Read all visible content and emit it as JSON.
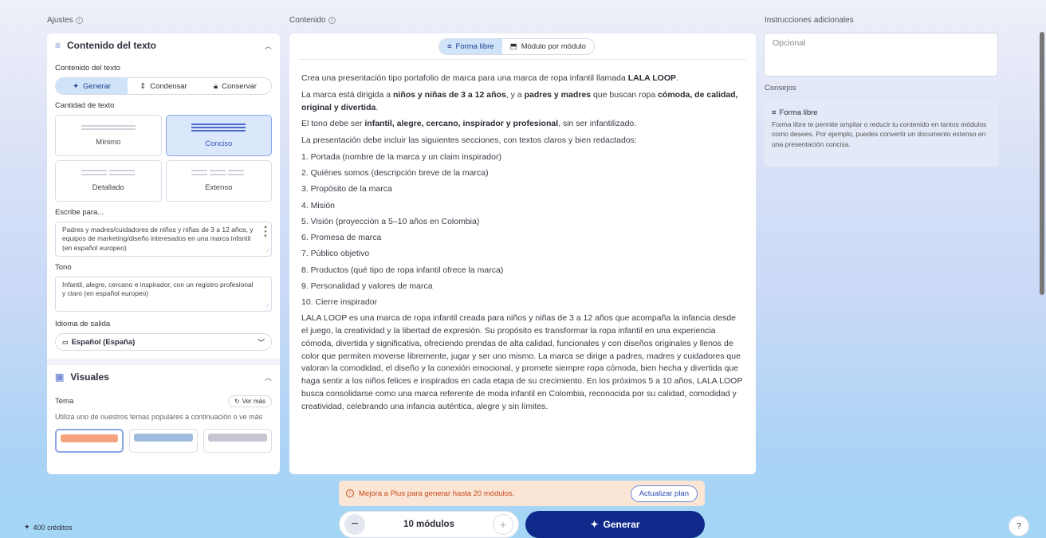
{
  "labels": {
    "ajustes": "Ajustes",
    "contenido": "Contenido",
    "instrucciones": "Instrucciones adicionales",
    "consejos": "Consejos"
  },
  "left": {
    "section_text": {
      "title": "Contenido del texto",
      "sub_label": "Contenido del texto",
      "modes": [
        "Generar",
        "Condensar",
        "Conservar"
      ],
      "cantidad_label": "Cantidad de texto",
      "amounts": [
        "Mínimo",
        "Conciso",
        "Detallado",
        "Extenso"
      ],
      "escribe_label": "Escribe para...",
      "escribe_value": "Padres y madres/cuidadores de niños y niñas de 3 a 12 años, y equipos de marketing/diseño interesados en una marca infantil (en español europeo)",
      "tono_label": "Tono",
      "tono_value": "Infantil, alegre, cercano e inspirador, con un registro profesional y claro (en español europeo)",
      "idioma_label": "Idioma de salida",
      "idioma_value": "Español (España)"
    },
    "section_visuals": {
      "title": "Visuales",
      "tema_label": "Tema",
      "ver_mas": "Ver más",
      "tema_desc": "Utiliza uno de nuestros temas populares a continuación o ve más"
    }
  },
  "center": {
    "tabs": [
      "Forma libre",
      "Módulo por módulo"
    ],
    "content": {
      "p1_a": "Crea una presentación tipo portafolio de marca para una marca de ropa infantil llamada ",
      "p1_b": "LALA LOOP",
      "p1_c": ".",
      "p2_a": "La marca está dirigida a ",
      "p2_b": "niños y niñas de 3 a 12 años",
      "p2_c": ", y a ",
      "p2_d": "padres y madres",
      "p2_e": " que buscan ropa ",
      "p2_f": "cómoda, de calidad, original y divertida",
      "p2_g": ".",
      "p3_a": "El tono debe ser ",
      "p3_b": "infantil, alegre, cercano, inspirador y profesional",
      "p3_c": ", sin ser infantilizado.",
      "p4": "La presentación debe incluir las siguientes secciones, con textos claros y bien redactados:",
      "list": [
        "1.  Portada (nombre de la marca y un claim inspirador)",
        "2.  Quiénes somos (descripción breve de la marca)",
        "3.  Propósito de la marca",
        "4.  Misión",
        "5.  Visión (proyección a 5–10 años en Colombia)",
        "6.  Promesa de marca",
        "7.  Público objetivo",
        "8.  Productos (qué tipo de ropa infantil ofrece la marca)",
        "9.  Personalidad y valores de marca",
        "10. Cierre inspirador"
      ],
      "p5": "LALA LOOP es una marca de ropa infantil creada para niños y niñas de 3 a 12 años que acompaña la infancia desde el juego, la creatividad y la libertad de expresión. Su propósito es transformar la ropa infantil en una experiencia cómoda, divertida y significativa, ofreciendo prendas de alta calidad, funcionales y con diseños originales y llenos de color que permiten moverse libremente, jugar y ser uno mismo. La marca se dirige a padres, madres y cuidadores que valoran la comodidad, el diseño y la conexión emocional, y promete siempre ropa cómoda, bien hecha y divertida que haga sentir a los niños felices e inspirados en cada etapa de su crecimiento. En los próximos 5 a 10 años, LALA LOOP busca consolidarse como una marca referente de moda infantil en Colombia, reconocida por su calidad, comodidad y creatividad, celebrando una infancia auténtica, alegre y sin límites."
    }
  },
  "right": {
    "placeholder": "Opcional",
    "tip_title": "Forma libre",
    "tip_body": "Forma libre te permite ampliar o reducir tu contenido en tantos módulos como desees. Por ejemplo, puedes convertir un documento extenso en una presentación concisa."
  },
  "bottom": {
    "banner_msg": "Mejora a Plus para generar hasta 20 módulos.",
    "upgrade": "Actualizar plan",
    "modules": "10 módulos",
    "generate": "Generar",
    "credits": "400 créditos",
    "help": "?"
  },
  "colors": {
    "accent": "#102a8c",
    "active_bg": "#cfe3f9",
    "banner_bg": "#fbe6d6",
    "banner_text": "#c4481c"
  }
}
